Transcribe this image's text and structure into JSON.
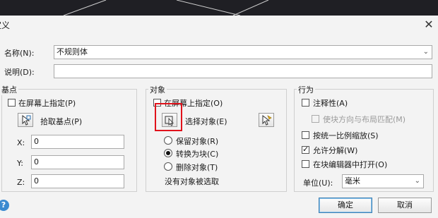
{
  "window": {
    "title": "块定义",
    "title_visible": "块定义",
    "close_glyph": "✕"
  },
  "name": {
    "label": "名称(N):",
    "value": "不规则体"
  },
  "description": {
    "label": "说明(D):",
    "value": ""
  },
  "basepoint": {
    "title": "基点",
    "specify_onscreen": "在屏幕上指定(P)",
    "pick_label": "拾取基点(P)",
    "x_label": "X:",
    "x_value": "0",
    "y_label": "Y:",
    "y_value": "0",
    "z_label": "Z:",
    "z_value": "0"
  },
  "objects": {
    "title": "对象",
    "specify_onscreen": "在屏幕上指定(O)",
    "select_label": "选择对象(E)",
    "retain": "保留对象(R)",
    "convert": "转换为块(C)",
    "delete": "删除对象(T)",
    "status": "没有对象被选取"
  },
  "behavior": {
    "title": "行为",
    "annotative": "注释性(A)",
    "match_orientation": "使块方向与布局匹配(M)",
    "scale_uniformly": "按统一比例缩放(S)",
    "allow_explode": "允许分解(W)",
    "open_in_editor": "在块编辑器中打开(O)",
    "units_label": "单位(U):",
    "units_value": "毫米"
  },
  "buttons": {
    "ok": "确定",
    "cancel": "取消"
  },
  "colors": {
    "highlight": "#e0121b",
    "dialog_bg": "#f3f3f3",
    "help": "#3b8ad0"
  }
}
